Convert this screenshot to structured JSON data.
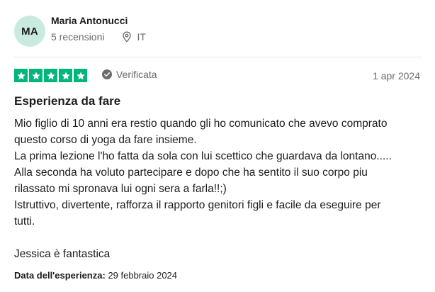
{
  "reviewer": {
    "initials": "MA",
    "name": "Maria Antonucci",
    "reviews_count": "5 recensioni",
    "country": "IT",
    "avatar_color": "#c9ebdf"
  },
  "rating": {
    "stars": 5,
    "max_stars": 5,
    "star_color": "#00b67a",
    "verified_label": "Verificata"
  },
  "review": {
    "date": "1 apr 2024",
    "title": "Esperienza da fare",
    "lines": [
      "Mio figlio di 10 anni era restio quando gli ho comunicato che avevo comprato",
      "questo corso di yoga da fare insieme.",
      "La prima lezione l'ho fatta da sola con lui scettico che guardava da lontano.....",
      "Alla seconda ha voluto partecipare e dopo che ha sentito il suo corpo piu",
      "rilassato mi spronava lui ogni sera a farla!!;)",
      "Istruttivo, divertente, rafforza il rapporto genitori figli e facile da eseguire per",
      "tutti."
    ],
    "signoff": "Jessica è fantastica",
    "experience_label": "Data dell'esperienza:",
    "experience_date": "29 febbraio 2024"
  },
  "icons": {
    "location": "map-pin-icon",
    "verified": "check-circle-icon",
    "star": "star-icon"
  }
}
